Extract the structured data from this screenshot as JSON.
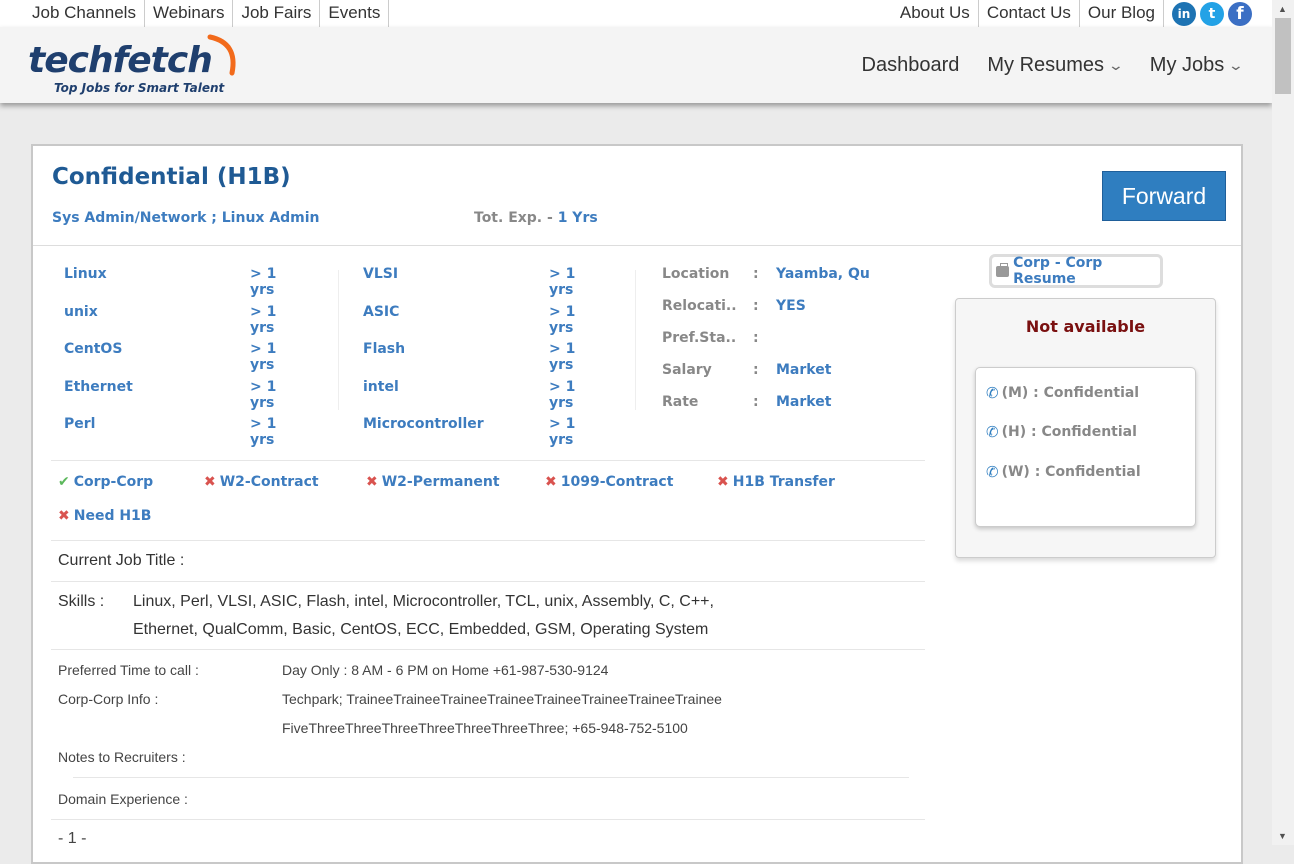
{
  "toplinks": {
    "left": [
      "Job Channels",
      "Webinars",
      "Job Fairs",
      "Events"
    ],
    "right": [
      "About Us",
      "Contact Us",
      "Our Blog"
    ]
  },
  "social": {
    "linkedin": "in",
    "twitter": "t",
    "facebook": "f"
  },
  "logo": {
    "text": "techfetch",
    "tagline": "Top Jobs for Smart Talent"
  },
  "nav": {
    "dashboard": "Dashboard",
    "my_resumes": "My Resumes",
    "my_jobs": "My Jobs"
  },
  "profile": {
    "title": "Confidential (H1B)",
    "role": "Sys Admin/Network ; Linux Admin",
    "tot_exp_label": "Tot. Exp. - ",
    "tot_exp_value": "1 Yrs",
    "forward_label": "Forward"
  },
  "skills_left": [
    {
      "name": "Linux",
      "yrs": "> 1 yrs"
    },
    {
      "name": "unix",
      "yrs": "> 1 yrs"
    },
    {
      "name": "CentOS",
      "yrs": "> 1 yrs"
    },
    {
      "name": "Ethernet",
      "yrs": "> 1 yrs"
    },
    {
      "name": "Perl",
      "yrs": "> 1 yrs"
    }
  ],
  "skills_right": [
    {
      "name": "VLSI",
      "yrs": "> 1 yrs"
    },
    {
      "name": "ASIC",
      "yrs": "> 1 yrs"
    },
    {
      "name": "Flash",
      "yrs": "> 1 yrs"
    },
    {
      "name": "intel",
      "yrs": "> 1 yrs"
    },
    {
      "name": "Microcontroller",
      "yrs": "> 1 yrs"
    }
  ],
  "info": [
    {
      "label": "Location",
      "value": "Yaamba, Qu"
    },
    {
      "label": "Relocati...",
      "value": "YES"
    },
    {
      "label": "Pref.Sta...",
      "value": ""
    },
    {
      "label": "Salary",
      "value": "Market"
    },
    {
      "label": "Rate",
      "value": "Market"
    }
  ],
  "colon": ":",
  "types": [
    {
      "label": "Corp-Corp",
      "ok": true
    },
    {
      "label": "W2-Contract",
      "ok": false
    },
    {
      "label": "W2-Permanent",
      "ok": false
    },
    {
      "label": "1099-Contract",
      "ok": false
    },
    {
      "label": "H1B Transfer",
      "ok": false
    },
    {
      "label": "Need H1B",
      "ok": false
    }
  ],
  "details": {
    "current_job_title_label": "Current Job Title :",
    "skills_label": "Skills :",
    "skills_line1": "Linux, Perl, VLSI, ASIC, Flash, intel, Microcontroller, TCL, unix, Assembly, C, C++,",
    "skills_line2": "Ethernet, QualComm, Basic, CentOS, ECC, Embedded, GSM, Operating System",
    "pref_time_label": "Preferred Time to call :",
    "pref_time_value": "Day Only : 8 AM - 6 PM on Home +61-987-530-9124",
    "corp_info_label": "Corp-Corp Info :",
    "corp_info_line1": "Techpark; TraineeTraineeTraineeTraineeTraineeTraineeTraineeTrainee",
    "corp_info_line2": "FiveThreeThreeThreeThreeThreeThreeThree; +65-948-752-5100",
    "notes_label": "Notes to Recruiters :",
    "domain_label": "Domain Experience :",
    "page_marker": "- 1 -"
  },
  "side": {
    "resume_badge": "Corp - Corp Resume",
    "not_available": "Not available",
    "phones": [
      "(M) : Confidential",
      "(H) : Confidential",
      "(W) : Confidential"
    ]
  },
  "colors": {
    "accent": "#2f7ec0",
    "title": "#1f5a94",
    "link": "#3d7cbf",
    "danger": "#d9534f",
    "ok": "#5cb85c",
    "notavail": "#7a1010"
  }
}
